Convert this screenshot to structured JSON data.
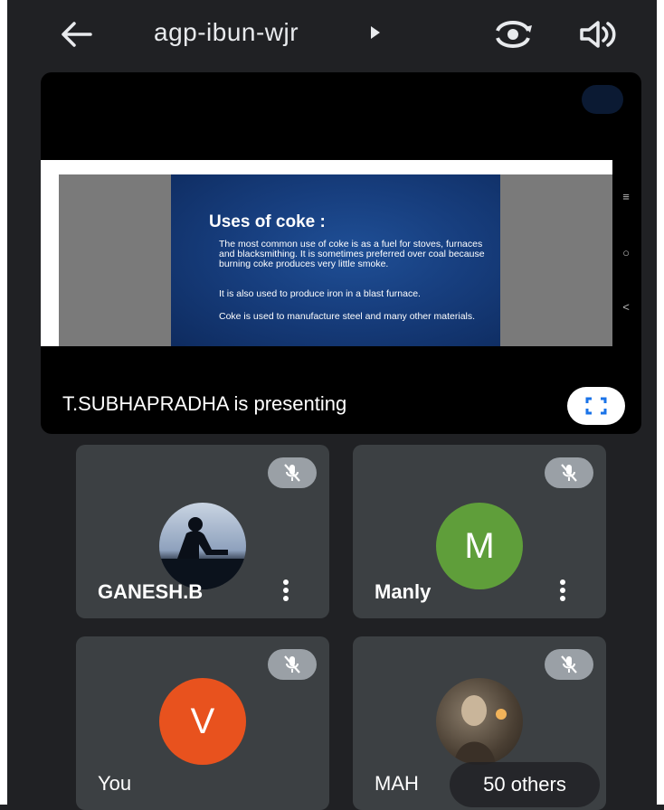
{
  "header": {
    "meeting_code": "agp-ibun-wjr",
    "icons": {
      "back": "arrow-left-icon",
      "switch_camera": "switch-camera-icon",
      "audio": "speaker-icon"
    }
  },
  "presentation": {
    "slide": {
      "title": "Uses of coke :",
      "bullets": [
        "The most common use of coke is as a fuel for stoves, furnaces and blacksmithing. It is sometimes preferred over coal because burning coke produces very little smoke.",
        "It is also used to produce iron in a blast furnace.",
        "Coke is used to manufacture steel and many other materials."
      ]
    },
    "presenting_text": "T.SUBHAPRADHA is presenting",
    "icons": {
      "fullscreen": "fullscreen-icon"
    }
  },
  "participants": [
    {
      "name": "GANESH.B",
      "avatar_type": "photo",
      "muted": true,
      "has_menu": true
    },
    {
      "name": "Manly",
      "initial": "M",
      "avatar_color": "#5f9e3a",
      "muted": true,
      "has_menu": true
    },
    {
      "name": "You",
      "initial": "V",
      "avatar_color": "#e8521e",
      "muted": true,
      "has_menu": false
    },
    {
      "name": "MAH",
      "avatar_type": "photo",
      "muted": true,
      "has_menu": false
    }
  ],
  "overflow": {
    "label": "50 others"
  },
  "colors": {
    "background": "#202124",
    "tile": "#3c4043",
    "mute_badge": "#9aa0a6"
  }
}
